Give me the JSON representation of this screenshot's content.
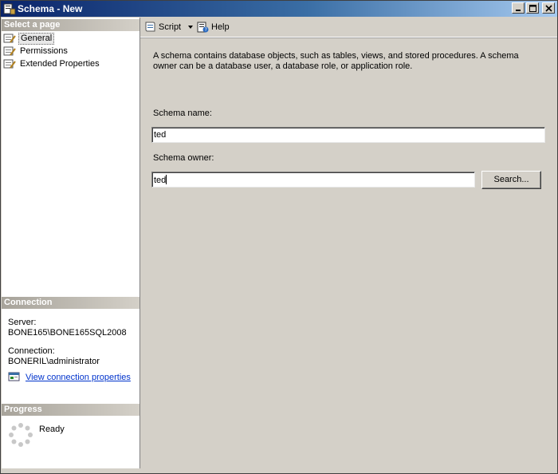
{
  "window": {
    "title": "Schema - New",
    "icon": "schema-app-icon",
    "controls": [
      "minimize-icon",
      "maximize-icon",
      "close-icon"
    ]
  },
  "left_pane": {
    "select_page_header": "Select a page",
    "pages": [
      {
        "label": "General",
        "icon": "page-wrench-icon",
        "selected": true
      },
      {
        "label": "Permissions",
        "icon": "page-wrench-icon",
        "selected": false
      },
      {
        "label": "Extended Properties",
        "icon": "page-wrench-icon",
        "selected": false
      }
    ],
    "connection_header": "Connection",
    "server_label": "Server:",
    "server_value": "BONE165\\BONE165SQL2008",
    "connection_label": "Connection:",
    "connection_value": "BONERIL\\administrator",
    "view_connection_link": "View connection properties",
    "progress_header": "Progress",
    "progress_status": "Ready"
  },
  "toolbar": {
    "script_label": "Script",
    "help_label": "Help"
  },
  "main": {
    "description": "A schema contains database objects, such as tables, views, and stored procedures. A schema owner can be a database user, a database role, or application role.",
    "schema_name_label": "Schema name:",
    "schema_name_value": "ted",
    "schema_owner_label": "Schema owner:",
    "schema_owner_value": "ted",
    "search_button": "Search..."
  }
}
